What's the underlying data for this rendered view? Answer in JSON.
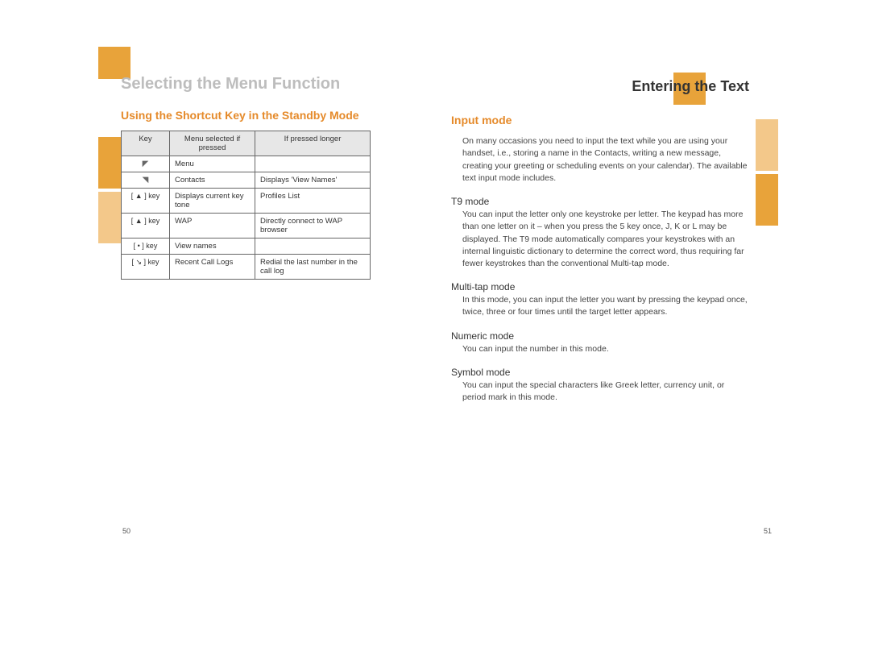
{
  "left": {
    "chapter": "Selecting the Menu Function",
    "section": "Using the Shortcut Key in the Standby Mode",
    "page_number": "50",
    "table": {
      "headers": [
        "Key",
        "Menu selected if pressed",
        "If pressed longer"
      ],
      "rows": [
        {
          "key_label": "",
          "menu": "Menu",
          "long": ""
        },
        {
          "key_label": "",
          "menu": "Contacts",
          "long": "Displays 'View Names'"
        },
        {
          "key_label": "[ ▲ ] key",
          "menu": "Displays current key tone",
          "long": "Profiles List"
        },
        {
          "key_label": "[ ▲ ] key",
          "menu": "WAP",
          "long": "Directly connect to WAP browser"
        },
        {
          "key_label": "[ • ] key",
          "menu": "View names",
          "long": ""
        },
        {
          "key_label": "[ ↘ ] key",
          "menu": "Recent Call Logs",
          "long": "Redial the last number in the call log"
        }
      ]
    }
  },
  "right": {
    "chapter": "Entering the Text",
    "section": "Input mode",
    "intro": "On many occasions you need to input the text while you are using your handset, i.e., storing a name in the Contacts, writing a new message, creating your greeting or scheduling events on your calendar). The available text input mode includes.",
    "page_number": "51",
    "modes": [
      {
        "title": "T9 mode",
        "body": "You can input the letter only one keystroke per letter. The keypad has more than one letter on it – when you press the 5 key once, J, K or L may be displayed. The T9 mode automatically compares your keystrokes with an internal linguistic dictionary to determine the correct word, thus requiring far fewer keystrokes than the conventional Multi-tap mode."
      },
      {
        "title": "Multi-tap mode",
        "body": "In this mode, you can input the letter you want by pressing the keypad once, twice, three or four times until the target letter appears."
      },
      {
        "title": "Numeric mode",
        "body": "You can input the number in this mode."
      },
      {
        "title": "Symbol mode",
        "body": "You can input the special characters like Greek letter, currency unit, or period mark in this mode."
      }
    ]
  }
}
